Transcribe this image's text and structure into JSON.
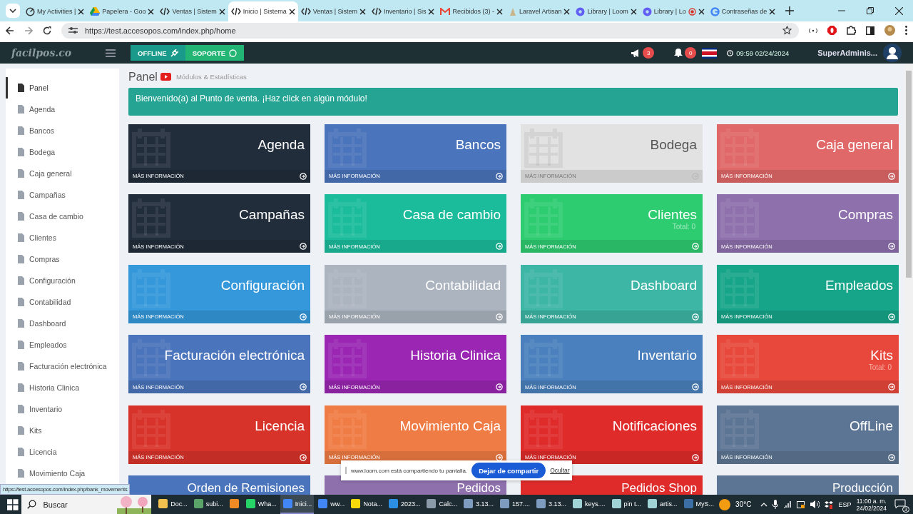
{
  "browser": {
    "tabs": [
      {
        "title": "My Activities |",
        "kind": "activity",
        "selected": false
      },
      {
        "title": "Papelera - Goo",
        "kind": "drive",
        "selected": false
      },
      {
        "title": "Ventas | Sistem",
        "kind": "code",
        "selected": false
      },
      {
        "title": "Inicio | Sistema",
        "kind": "code",
        "selected": true
      },
      {
        "title": "Ventas | Sistem",
        "kind": "code",
        "selected": false
      },
      {
        "title": "Inventario | Sis",
        "kind": "code",
        "selected": false
      },
      {
        "title": "Recibidos (3) -",
        "kind": "mail",
        "selected": false
      },
      {
        "title": "Laravel Artisan",
        "kind": "laravel",
        "selected": false
      },
      {
        "title": "Library | Loom",
        "kind": "loom",
        "selected": false
      },
      {
        "title": "Library | Lo",
        "kind": "loom",
        "selected": false,
        "recording": true
      },
      {
        "title": "Contraseñas de",
        "kind": "google",
        "selected": false
      }
    ],
    "url": "https://test.accesopos.com/index.php/home",
    "hover_url": "https://test.accesopos.com/index.php/bank_movements"
  },
  "header": {
    "logo": "facilpos.co",
    "offline_button": "OFFLINE",
    "support_button": "SOPORTE",
    "announcements": "3",
    "notifications": "0",
    "clock": "09:59 02/24/2024",
    "user": "SuperAdminis..."
  },
  "sidebar": {
    "items": [
      {
        "label": "Panel",
        "selected": true
      },
      {
        "label": "Agenda",
        "selected": false
      },
      {
        "label": "Bancos",
        "selected": false
      },
      {
        "label": "Bodega",
        "selected": false
      },
      {
        "label": "Caja general",
        "selected": false
      },
      {
        "label": "Campañas",
        "selected": false
      },
      {
        "label": "Casa de cambio",
        "selected": false
      },
      {
        "label": "Clientes",
        "selected": false
      },
      {
        "label": "Compras",
        "selected": false
      },
      {
        "label": "Configuración",
        "selected": false
      },
      {
        "label": "Contabilidad",
        "selected": false
      },
      {
        "label": "Dashboard",
        "selected": false
      },
      {
        "label": "Empleados",
        "selected": false
      },
      {
        "label": "Facturación electrónica",
        "selected": false
      },
      {
        "label": "Historia Clinica",
        "selected": false
      },
      {
        "label": "Inventario",
        "selected": false
      },
      {
        "label": "Kits",
        "selected": false
      },
      {
        "label": "Licencia",
        "selected": false
      },
      {
        "label": "Movimiento Caja",
        "selected": false
      }
    ]
  },
  "page": {
    "title": "Panel",
    "subtitle": "Módulos & Estadísticas",
    "alert": "Bienvenido(a) al Punto de venta. ¡Haz click en algún módulo!"
  },
  "tiles": [
    {
      "title": "Agenda",
      "link": "MÁS INFORMACIÓN",
      "color": "#222d3c"
    },
    {
      "title": "Bancos",
      "link": "MÁS INFORMACIÓN",
      "color": "#4a74bb"
    },
    {
      "title": "Bodega",
      "link": "MÁS INFORMACIÓN",
      "color": "#e2e2e2"
    },
    {
      "title": "Caja general",
      "link": "MÁS INFORMACIÓN",
      "color": "#e06868"
    },
    {
      "title": "Campañas",
      "link": "MÁS INFORMACIÓN",
      "color": "#222d3c"
    },
    {
      "title": "Casa de cambio",
      "link": "MÁS INFORMACIÓN",
      "color": "#1bbc9b"
    },
    {
      "title": "Clientes",
      "link": "MÁS INFORMACIÓN",
      "color": "#2ecc71",
      "note": "Total: 0"
    },
    {
      "title": "Compras",
      "link": "MÁS INFORMACIÓN",
      "color": "#8e70ad"
    },
    {
      "title": "Configuración",
      "link": "MÁS INFORMACIÓN",
      "color": "#3498db"
    },
    {
      "title": "Contabilidad",
      "link": "MÁS INFORMACIÓN",
      "color": "#abb4bf"
    },
    {
      "title": "Dashboard",
      "link": "MÁS INFORMACIÓN",
      "color": "#3db6a6"
    },
    {
      "title": "Empleados",
      "link": "MÁS INFORMACIÓN",
      "color": "#17a589"
    },
    {
      "title": "Facturación electrónica",
      "link": "MÁS INFORMACIÓN",
      "color": "#4a74bb"
    },
    {
      "title": "Historia Clinica",
      "link": "MÁS INFORMACIÓN",
      "color": "#9a26b3"
    },
    {
      "title": "Inventario",
      "link": "MÁS INFORMACIÓN",
      "color": "#4a80bd"
    },
    {
      "title": "Kits",
      "link": "MÁS INFORMACIÓN",
      "color": "#e8483b",
      "note": "Total: 0"
    },
    {
      "title": "Licencia",
      "link": "MÁS INFORMACIÓN",
      "color": "#d8332a"
    },
    {
      "title": "Movimiento Caja",
      "link": "MÁS INFORMACIÓN",
      "color": "#f07c45"
    },
    {
      "title": "Notificaciones",
      "link": "MÁS INFORMACIÓN",
      "color": "#e02b2b"
    },
    {
      "title": "OffLine",
      "link": "MÁS INFORMACIÓN",
      "color": "#5d7594"
    },
    {
      "title": "Orden de Remisiones",
      "color": "#4a74bb"
    },
    {
      "title": "Pedidos",
      "color": "#8e70ad"
    },
    {
      "title": "Pedidos Shop",
      "color": "#e02b2b"
    },
    {
      "title": "Producción",
      "color": "#5d7594"
    }
  ],
  "share_bar": {
    "message": "www.loom.com está compartiendo tu pantalla.",
    "stop_button": "Dejar de compartir",
    "hide_link": "Ocultar"
  },
  "taskbar": {
    "search": "Buscar",
    "apps": [
      {
        "label": "Doc...",
        "color": "#f2c14e",
        "selected": false
      },
      {
        "label": "subi...",
        "color": "#5aa469",
        "selected": false
      },
      {
        "color": "#f08a24",
        "selected": false
      },
      {
        "label": "Wha...",
        "color": "#25d366",
        "selected": false
      },
      {
        "label": "Inici...",
        "color": "#4285f4",
        "selected": true
      },
      {
        "label": "ww...",
        "color": "#4285f4",
        "selected": false
      },
      {
        "label": "Nota...",
        "color": "#f5d90a",
        "selected": false
      },
      {
        "label": "2023...",
        "color": "#2b8fe3",
        "selected": false
      },
      {
        "label": "Calc...",
        "color": "#8a9aa8",
        "selected": false
      },
      {
        "label": "3.13...",
        "color": "#7d9cc0",
        "selected": false
      },
      {
        "label": "157....",
        "color": "#7d9cc0",
        "selected": false
      },
      {
        "label": "3.13...",
        "color": "#7d9cc0",
        "selected": false
      },
      {
        "label": "keys....",
        "color": "#9fd3d6",
        "selected": false
      },
      {
        "label": "pin t...",
        "color": "#9fd3d6",
        "selected": false
      },
      {
        "label": "artis...",
        "color": "#9fd3d6",
        "selected": false
      },
      {
        "label": "MyS...",
        "color": "#3a6ea5",
        "selected": false
      }
    ],
    "weather": "30°C",
    "language": "ESP",
    "time": "11:00 a. m.",
    "date": "24/02/2024",
    "notification_count": "3"
  }
}
